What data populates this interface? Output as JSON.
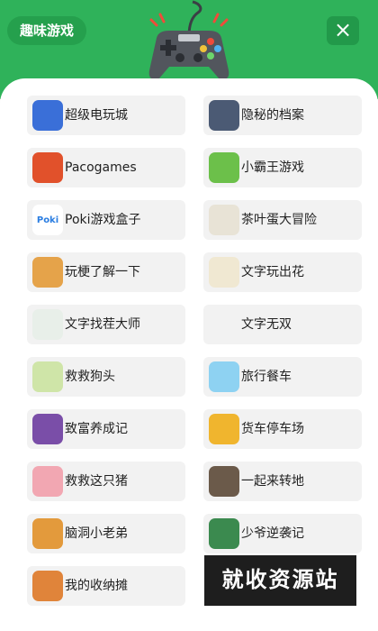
{
  "header": {
    "title": "趣味游戏",
    "close_icon": "×"
  },
  "games": [
    {
      "label": "超级电玩城",
      "icon": "arcade-icon",
      "color": "#3a6fd8"
    },
    {
      "label": "隐秘的档案",
      "icon": "car-archive-icon",
      "color": "#4b5a74"
    },
    {
      "label": "Pacogames",
      "icon": "pacogames-icon",
      "color": "#e1512b"
    },
    {
      "label": "小霸王游戏",
      "icon": "yikes-icon",
      "color": "#6cc04a"
    },
    {
      "label": "Poki游戏盒子",
      "icon": "poki-icon",
      "color": "#ffffff"
    },
    {
      "label": "茶叶蛋大冒险",
      "icon": "egg-icon",
      "color": "#e8e3d6"
    },
    {
      "label": "玩梗了解一下",
      "icon": "meme-icon",
      "color": "#e5a34a"
    },
    {
      "label": "文字玩出花",
      "icon": "text-flower-icon",
      "color": "#f0e8d2"
    },
    {
      "label": "文字找茬大师",
      "icon": "text-find-icon",
      "color": "#e8efe9"
    },
    {
      "label": "文字无双",
      "icon": "text-warrior-icon",
      "color": "#f2f2f2"
    },
    {
      "label": "救救狗头",
      "icon": "dog-icon",
      "color": "#cfe5a8"
    },
    {
      "label": "旅行餐车",
      "icon": "food-truck-icon",
      "color": "#8ed2f2"
    },
    {
      "label": "致富养成记",
      "icon": "rich-icon",
      "color": "#7a4ea8"
    },
    {
      "label": "货车停车场",
      "icon": "truck-icon",
      "color": "#f0b52e"
    },
    {
      "label": "救救这只猪",
      "icon": "pig-icon",
      "color": "#f2a7b2"
    },
    {
      "label": "一起来转地",
      "icon": "drill-icon",
      "color": "#6b5a4a"
    },
    {
      "label": "脑洞小老弟",
      "icon": "brain-icon",
      "color": "#e39a3c"
    },
    {
      "label": "少爷逆袭记",
      "icon": "master-icon",
      "color": "#3b8a4f"
    },
    {
      "label": "我的收纳摊",
      "icon": "storage-icon",
      "color": "#e0843a"
    }
  ],
  "watermark": "就收资源站"
}
